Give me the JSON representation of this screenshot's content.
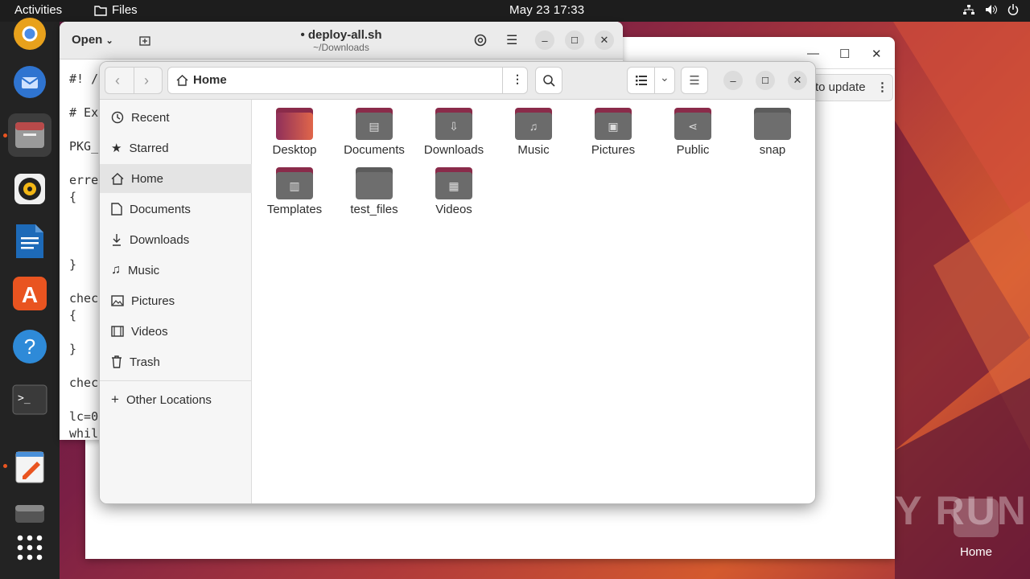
{
  "topbar": {
    "activities": "Activities",
    "app_name": "Files",
    "clock": "May 23  17:33"
  },
  "background_window": {
    "update_label": "to update"
  },
  "gedit": {
    "open_label": "Open",
    "title": "• deploy-all.sh",
    "subtitle": "~/Downloads",
    "code_lines": [
      "#! /(",
      "# Ext",
      "PKG_",
      "errex",
      "{",
      "}",
      "check",
      "{",
      "}",
      "check",
      "lc=0",
      "while"
    ]
  },
  "files": {
    "path_label": "Home",
    "sidebar": [
      {
        "label": "Recent",
        "icon": "clock-icon"
      },
      {
        "label": "Starred",
        "icon": "star-icon"
      },
      {
        "label": "Home",
        "icon": "home-icon"
      },
      {
        "label": "Documents",
        "icon": "document-icon"
      },
      {
        "label": "Downloads",
        "icon": "download-icon"
      },
      {
        "label": "Music",
        "icon": "music-icon"
      },
      {
        "label": "Pictures",
        "icon": "picture-icon"
      },
      {
        "label": "Videos",
        "icon": "video-icon"
      },
      {
        "label": "Trash",
        "icon": "trash-icon"
      }
    ],
    "other_locations": "Other Locations",
    "folders": [
      {
        "label": "Desktop"
      },
      {
        "label": "Documents"
      },
      {
        "label": "Downloads"
      },
      {
        "label": "Music"
      },
      {
        "label": "Pictures"
      },
      {
        "label": "Public"
      },
      {
        "label": "snap"
      },
      {
        "label": "Templates"
      },
      {
        "label": "test_files"
      },
      {
        "label": "Videos"
      }
    ]
  },
  "desktop": {
    "home_label": "Home",
    "watermark": "ANY RUN"
  },
  "colors": {
    "accent": "#e95420",
    "folder_tab": "#8a2b4a",
    "topbar": "#1d1d1d"
  }
}
